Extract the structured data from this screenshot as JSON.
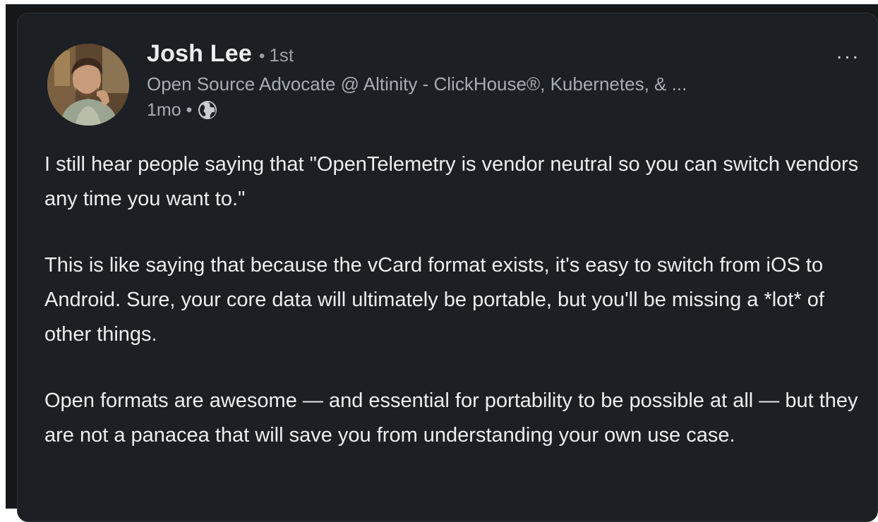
{
  "author": {
    "name": "Josh Lee",
    "separator": "•",
    "degree": "1st",
    "headline": "Open Source Advocate @ Altinity - ClickHouse®, Kubernetes, & ...",
    "time": "1mo",
    "visibility_icon": "globe-icon"
  },
  "more_menu": {
    "label": "...",
    "icon": "more-options-icon"
  },
  "post": {
    "paragraphs": [
      "I still hear people saying that \"OpenTelemetry is vendor neutral so you can switch vendors any time you want to.\"",
      "This is like saying that because the vCard format exists, it's easy to switch from iOS to Android. Sure, your core data will ultimately be portable, but you'll be missing a *lot* of other things.",
      "Open formats are awesome — and essential for portability to be possible at all — but they are not a panacea that will save you from understanding your own use case."
    ]
  },
  "colors": {
    "background": "#1c1f23",
    "text_primary": "#eceff1",
    "text_secondary": "#a7adb4"
  }
}
